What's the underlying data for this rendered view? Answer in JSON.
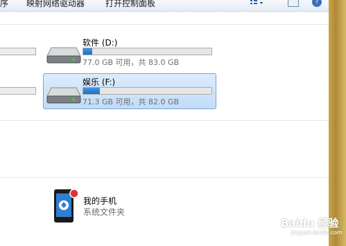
{
  "toolbar": {
    "item_partial_left": "序",
    "map_network_drive": "映射网络驱动器",
    "open_control_panel": "打开控制面板",
    "views_icon": "views-icon",
    "pane_icon": "preview-pane-icon",
    "help_label": "?"
  },
  "drives": [
    {
      "name": "软件 (D:)",
      "info": "77.0 GB 可用，共 83.0 GB",
      "used_fraction": 0.07,
      "selected": false
    },
    {
      "name": "娱乐 (F:)",
      "info": "71.3 GB 可用，共 82.0 GB",
      "used_fraction": 0.13,
      "selected": true
    }
  ],
  "portable": {
    "name": "我的手机",
    "subtitle": "系统文件夹"
  },
  "watermark": {
    "text": "Baidu 经验",
    "sub": "jingyan.baidu.com"
  },
  "colors": {
    "bar_fill": "#2a82d8",
    "selection": "#cce4fb",
    "selection_border": "#7da2ce"
  }
}
